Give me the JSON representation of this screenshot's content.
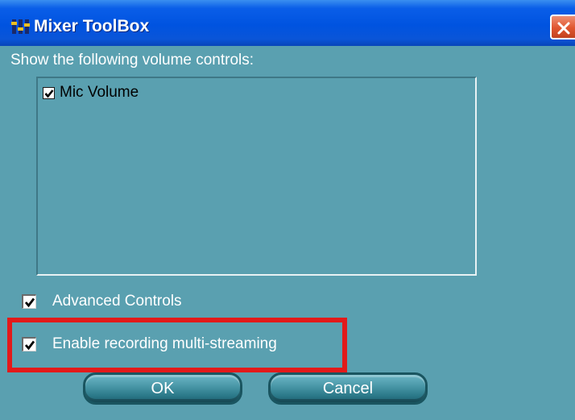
{
  "window": {
    "title": "Mixer ToolBox",
    "icon": "mixer-app-icon",
    "close_icon": "close-icon"
  },
  "volume_controls": {
    "prompt": "Show the following volume controls:",
    "items": [
      {
        "label": "Mic Volume",
        "checked": true
      }
    ]
  },
  "options": {
    "advanced_controls": {
      "label": "Advanced Controls",
      "checked": true
    },
    "multi_streaming": {
      "label": "Enable recording multi-streaming",
      "checked": true,
      "highlighted": true
    }
  },
  "buttons": {
    "ok": "OK",
    "cancel": "Cancel"
  },
  "colors": {
    "background": "#5aa0b0",
    "titlebar": "#0053e0",
    "close_button": "#e0552f",
    "highlight_box": "#e21a1a",
    "button": "#4a98a8"
  }
}
